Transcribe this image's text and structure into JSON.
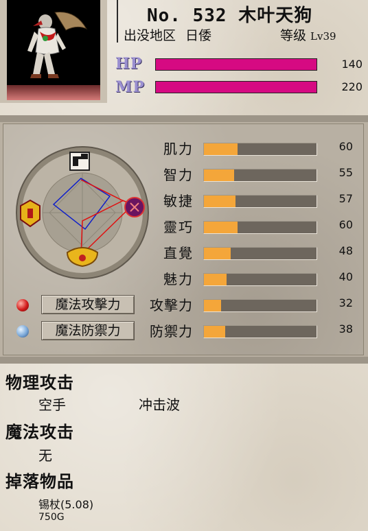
{
  "monster": {
    "title": "No. 532 木叶天狗",
    "origin_label": "出没地区",
    "origin_value": "日倭",
    "level_label": "等级",
    "level_value": "Lv39"
  },
  "vitals": [
    {
      "label": "HP",
      "value": "140",
      "fill": 1.0
    },
    {
      "label": "MP",
      "value": "220",
      "fill": 1.0
    }
  ],
  "stats": [
    {
      "label": "肌力",
      "value": "60",
      "fill": 0.3
    },
    {
      "label": "智力",
      "value": "55",
      "fill": 0.27
    },
    {
      "label": "敏捷",
      "value": "57",
      "fill": 0.28
    },
    {
      "label": "靈巧",
      "value": "60",
      "fill": 0.3
    },
    {
      "label": "直覺",
      "value": "48",
      "fill": 0.24
    },
    {
      "label": "魅力",
      "value": "40",
      "fill": 0.2
    },
    {
      "label": "攻擊力",
      "value": "32",
      "fill": 0.15
    },
    {
      "label": "防禦力",
      "value": "38",
      "fill": 0.19
    }
  ],
  "magic_buttons": [
    {
      "label": "魔法攻擊力"
    },
    {
      "label": "魔法防禦力"
    }
  ],
  "sections": {
    "physical_title": "物理攻击",
    "physical_items": [
      "空手",
      "冲击波"
    ],
    "magic_title": "魔法攻击",
    "magic_items": [
      "无"
    ],
    "drop_title": "掉落物品",
    "drop_item": "锡杖(5.08)",
    "drop_gold": "750G"
  },
  "colors": {
    "hp_mp_fill": "#d60a82",
    "stat_fill": "#f4a63a",
    "radar_blue": "#1020c8",
    "radar_red": "#e01010"
  }
}
